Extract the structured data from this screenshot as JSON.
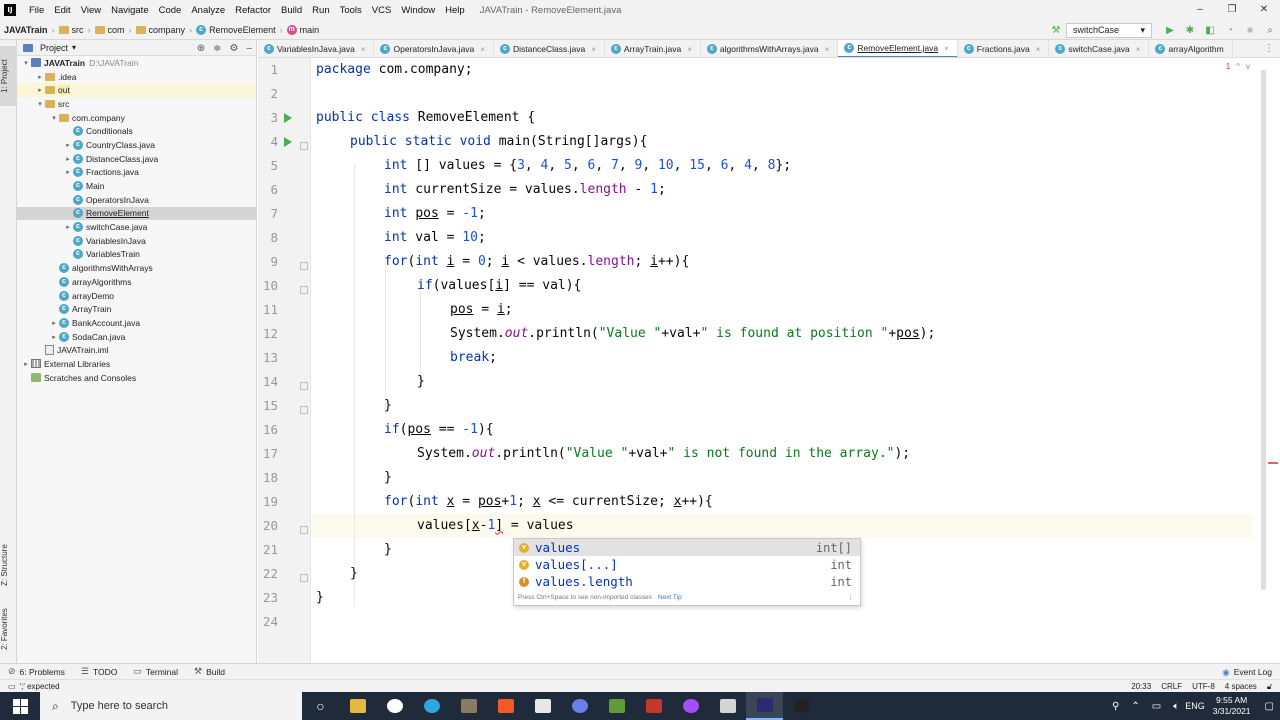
{
  "menu": {
    "app_icon": "IJ",
    "items": [
      "File",
      "Edit",
      "View",
      "Navigate",
      "Code",
      "Analyze",
      "Refactor",
      "Build",
      "Run",
      "Tools",
      "VCS",
      "Window",
      "Help"
    ],
    "window_title": "JAVATrain - RemoveElement.java",
    "window_buttons": [
      "–",
      "❐",
      "✕"
    ]
  },
  "navbar": {
    "crumbs": [
      "JAVATrain",
      "src",
      "com",
      "company",
      "RemoveElement",
      "main"
    ],
    "run_config": "switchCase"
  },
  "left_stripe": {
    "project": "1: Project",
    "structure": "Z: Structure",
    "favorites": "2: Favorites"
  },
  "project": {
    "title": "Project",
    "tree": [
      {
        "label": "JAVATrain",
        "extra": "D:\\JAVATrain",
        "indent": 0,
        "arrow": "▾",
        "icon": "module"
      },
      {
        "label": ".idea",
        "indent": 1,
        "arrow": "▸",
        "icon": "folder"
      },
      {
        "label": "out",
        "indent": 1,
        "arrow": "▸",
        "icon": "folder",
        "hl": "out"
      },
      {
        "label": "src",
        "indent": 1,
        "arrow": "▾",
        "icon": "folder"
      },
      {
        "label": "com.company",
        "indent": 2,
        "arrow": "▾",
        "icon": "folder"
      },
      {
        "label": "Conditionals",
        "indent": 3,
        "arrow": "",
        "icon": "class"
      },
      {
        "label": "CountryClass.java",
        "indent": 3,
        "arrow": "▸",
        "icon": "class"
      },
      {
        "label": "DistanceClass.java",
        "indent": 3,
        "arrow": "▸",
        "icon": "class"
      },
      {
        "label": "Fractions.java",
        "indent": 3,
        "arrow": "▸",
        "icon": "class"
      },
      {
        "label": "Main",
        "indent": 3,
        "arrow": "",
        "icon": "class"
      },
      {
        "label": "OperatorsInJava",
        "indent": 3,
        "arrow": "",
        "icon": "class"
      },
      {
        "label": "RemoveElement",
        "indent": 3,
        "arrow": "",
        "icon": "class",
        "sel": true
      },
      {
        "label": "switchCase.java",
        "indent": 3,
        "arrow": "▸",
        "icon": "class"
      },
      {
        "label": "VariablesInJava",
        "indent": 3,
        "arrow": "",
        "icon": "class"
      },
      {
        "label": "VariablesTrain",
        "indent": 3,
        "arrow": "",
        "icon": "class"
      },
      {
        "label": "algorithmsWithArrays",
        "indent": 2,
        "arrow": "",
        "icon": "class"
      },
      {
        "label": "arrayAlgorithms",
        "indent": 2,
        "arrow": "",
        "icon": "class"
      },
      {
        "label": "arrayDemo",
        "indent": 2,
        "arrow": "",
        "icon": "class"
      },
      {
        "label": "ArrayTrain",
        "indent": 2,
        "arrow": "",
        "icon": "class"
      },
      {
        "label": "BankAccount.java",
        "indent": 2,
        "arrow": "▸",
        "icon": "class"
      },
      {
        "label": "SodaCan.java",
        "indent": 2,
        "arrow": "▸",
        "icon": "class"
      },
      {
        "label": "JAVATrain.iml",
        "indent": 1,
        "arrow": "",
        "icon": "iml"
      },
      {
        "label": "External Libraries",
        "indent": 0,
        "arrow": "▸",
        "icon": "lib"
      },
      {
        "label": "Scratches and Consoles",
        "indent": 0,
        "arrow": "",
        "icon": "scratch"
      }
    ]
  },
  "tabs": [
    "VariablesInJava.java",
    "OperatorsInJava.java",
    "DistanceClass.java",
    "ArrayTrain.java",
    "algorithmsWithArrays.java",
    "RemoveElement.java",
    "Fractions.java",
    "switchCase.java",
    "arrayAlgorithm"
  ],
  "active_tab": 5,
  "editor": {
    "line_numbers": [
      "1",
      "2",
      "3",
      "4",
      "5",
      "6",
      "7",
      "8",
      "9",
      "10",
      "11",
      "12",
      "13",
      "14",
      "15",
      "16",
      "17",
      "18",
      "19",
      "20",
      "21",
      "22",
      "23",
      "24"
    ],
    "inspection": [
      "1",
      "^",
      "v"
    ],
    "code_text": {
      "l1a": "package",
      "l1b": " com.company;",
      "l3a": "public class",
      "l3b": " RemoveElement {",
      "l4a": "public static void",
      "l4b": " main(String[]args){",
      "l5a": "int",
      "l5b": " [] values = {",
      "l5c": "3",
      "l5d": "4",
      "l5e": "5",
      "l5f": "6",
      "l5g": "7",
      "l5h": "9",
      "l5i": "10",
      "l5j": "15",
      "l5k": "6",
      "l5l": "4",
      "l5m": "8",
      "l5n": "};",
      "l6a": "int",
      "l6b": " currentSize = values.",
      "l6c": "length",
      "l6d": " - ",
      "l6e": "1",
      "l6f": ";",
      "l7a": "int",
      "l7b": " ",
      "l7c": "pos",
      "l7d": " = ",
      "l7e": "-1",
      "l7f": ";",
      "l8a": "int",
      "l8b": " val = ",
      "l8c": "10",
      "l8d": ";",
      "l9a": "for",
      "l9b": "(",
      "l9c": "int",
      "l9d": " ",
      "l9e": "i",
      "l9f": " = ",
      "l9g": "0",
      "l9h": "; ",
      "l9i": "i",
      "l9j": " < values.",
      "l9k": "length",
      "l9l": "; ",
      "l9m": "i",
      "l9n": "++){",
      "l10a": "if",
      "l10b": "(values[",
      "l10c": "i",
      "l10d": "] == val){",
      "l11a": "pos",
      "l11b": " = ",
      "l11c": "i",
      "l11d": ";",
      "l12a": "System.",
      "l12b": "out",
      "l12c": ".println(",
      "l12d": "\"Value \"",
      "l12e": "+val+",
      "l12f": "\" is found at position \"",
      "l12g": "+",
      "l12h": "pos",
      "l12i": ");",
      "l13a": "break",
      "l13b": ";",
      "l14": "}",
      "l15": "}",
      "l16a": "if",
      "l16b": "(",
      "l16c": "pos",
      "l16d": " == ",
      "l16e": "-1",
      "l16f": "){",
      "l17a": "System.",
      "l17b": "out",
      "l17c": ".println(",
      "l17d": "\"Value \"",
      "l17e": "+val+",
      "l17f": "\" is not found in the array.\"",
      "l17g": ");",
      "l18": "}",
      "l19a": "for",
      "l19b": "(",
      "l19c": "int",
      "l19d": " ",
      "l19e": "x",
      "l19f": " = ",
      "l19g": "pos",
      "l19h": "+",
      "l19i": "1",
      "l19j": "; ",
      "l19k": "x",
      "l19l": " <= currentSize; ",
      "l19m": "x",
      "l19n": "++){",
      "l20a": "values[",
      "l20b": "x",
      "l20c": "-",
      "l20d": "1",
      "l20e": "]",
      "l20f": " = values",
      "l21": "}",
      "l22": "}",
      "l23": "}"
    }
  },
  "completion": {
    "items": [
      {
        "name": "values",
        "type": "int[]",
        "icon": "v"
      },
      {
        "name": "values[...]",
        "type": "int",
        "icon": "v"
      },
      {
        "name": "values.length",
        "type": "int",
        "icon": "f"
      }
    ],
    "hint": "Press Ctrl+Space to see non-imported classes",
    "next_tip": "Next Tip"
  },
  "bottom_tools": [
    {
      "icon": "⊘",
      "label": "6: Problems"
    },
    {
      "icon": "☰",
      "label": "TODO"
    },
    {
      "icon": "▭",
      "label": "Terminal"
    },
    {
      "icon": "⚒",
      "label": "Build"
    }
  ],
  "event_log": "Event Log",
  "status": {
    "left": "';' expected",
    "position": "20:33",
    "line_sep": "CRLF",
    "encoding": "UTF-8",
    "indent": "4 spaces"
  },
  "taskbar": {
    "search_placeholder": "Type here to search",
    "apps": [
      {
        "name": "file-explorer",
        "color": "#e7b83f"
      },
      {
        "name": "settings",
        "color": "#ffffff"
      },
      {
        "name": "edge",
        "color": "#2ea7e0"
      },
      {
        "name": "gimp",
        "color": "#8a7a66"
      },
      {
        "name": "brave",
        "color": "#f15a24"
      },
      {
        "name": "notepad",
        "color": "#e8e8e8"
      },
      {
        "name": "discord",
        "color": "#6c7fe8"
      },
      {
        "name": "minecraft",
        "color": "#5e9c3a"
      },
      {
        "name": "app-red",
        "color": "#c0392b"
      },
      {
        "name": "messenger",
        "color": "#a64dff"
      },
      {
        "name": "scanner",
        "color": "#d5d5d5"
      },
      {
        "name": "intellij",
        "color": "#2b2b6e"
      },
      {
        "name": "obs",
        "color": "#222222"
      }
    ],
    "lang": "ENG",
    "time": "9:55 AM",
    "date": "3/31/2021"
  }
}
